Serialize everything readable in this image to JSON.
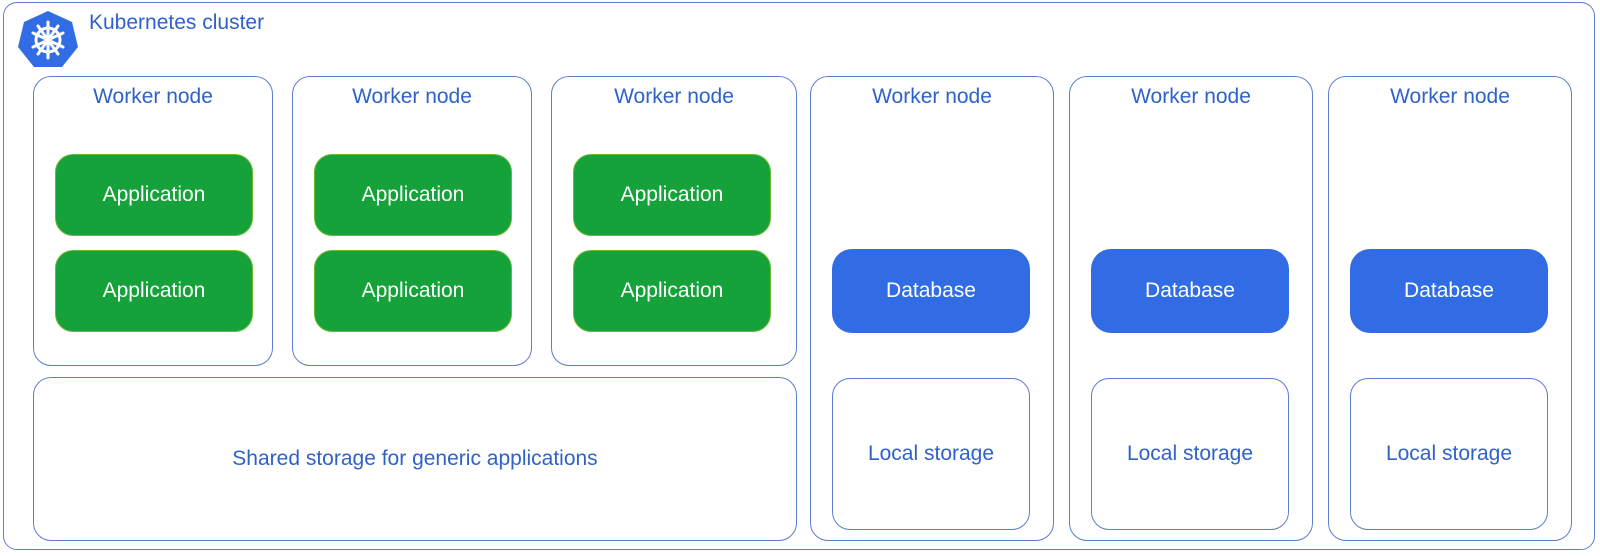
{
  "cluster": {
    "title": "Kubernetes cluster",
    "logo_icon": "kubernetes-helm-wheel-icon",
    "colors": {
      "primary": "#326ce5",
      "application": "#16a23a",
      "border": "#5b7fd0",
      "text": "#2f62c9"
    }
  },
  "app_nodes": [
    {
      "title": "Worker node",
      "apps": [
        "Application",
        "Application"
      ]
    },
    {
      "title": "Worker node",
      "apps": [
        "Application",
        "Application"
      ]
    },
    {
      "title": "Worker node",
      "apps": [
        "Application",
        "Application"
      ]
    }
  ],
  "shared_storage": {
    "label": "Shared storage for generic applications"
  },
  "db_nodes": [
    {
      "title": "Worker node",
      "database": "Database",
      "storage": "Local storage"
    },
    {
      "title": "Worker node",
      "database": "Database",
      "storage": "Local storage"
    },
    {
      "title": "Worker node",
      "database": "Database",
      "storage": "Local storage"
    }
  ]
}
